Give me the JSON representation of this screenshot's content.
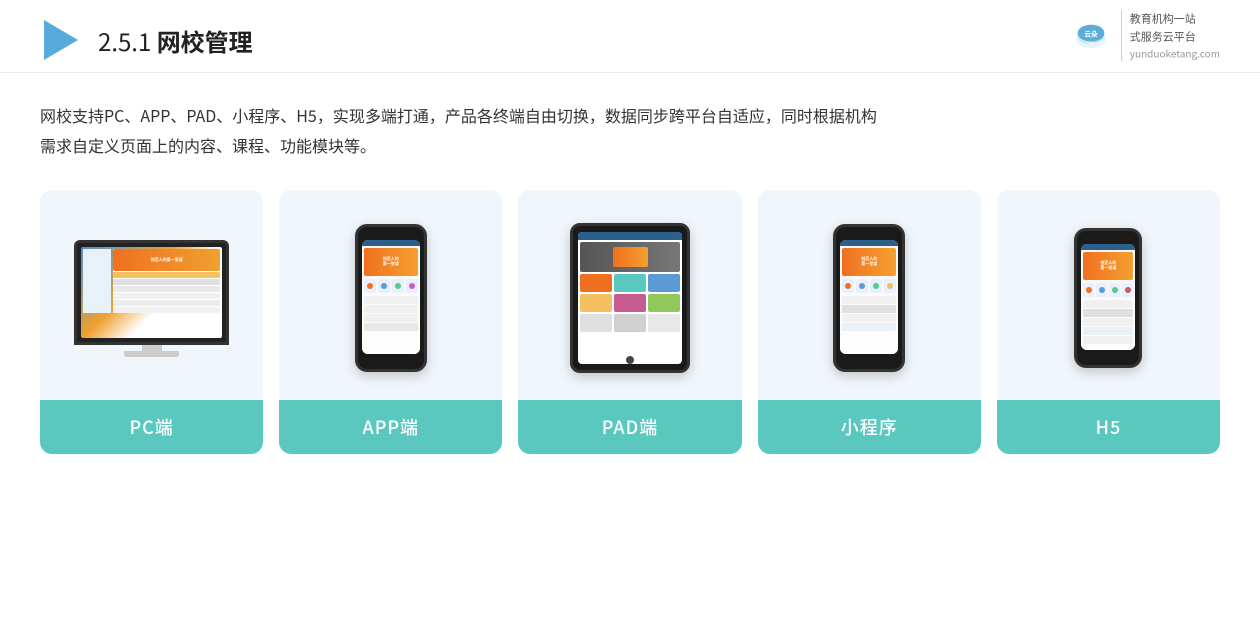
{
  "header": {
    "title_prefix": "2.5.1 ",
    "title_main": "网校管理",
    "brand_domain": "yunduoketang.com",
    "brand_line1": "教育机构一站",
    "brand_line2": "式服务云平台"
  },
  "description": {
    "text_line1": "网校支持PC、APP、PAD、小程序、H5，实现多端打通，产品各终端自由切换，数据同步跨平台自适应，同时根据机构",
    "text_line2": "需求自定义页面上的内容、课程、功能模块等。"
  },
  "cards": [
    {
      "id": "pc",
      "label": "PC端",
      "type": "pc"
    },
    {
      "id": "app",
      "label": "APP端",
      "type": "phone"
    },
    {
      "id": "pad",
      "label": "PAD端",
      "type": "tablet"
    },
    {
      "id": "miniprogram",
      "label": "小程序",
      "type": "phone"
    },
    {
      "id": "h5",
      "label": "H5",
      "type": "phone"
    }
  ],
  "colors": {
    "card_bg": "#eef5fb",
    "label_bar": "#5bc8c0",
    "label_text": "#ffffff"
  }
}
